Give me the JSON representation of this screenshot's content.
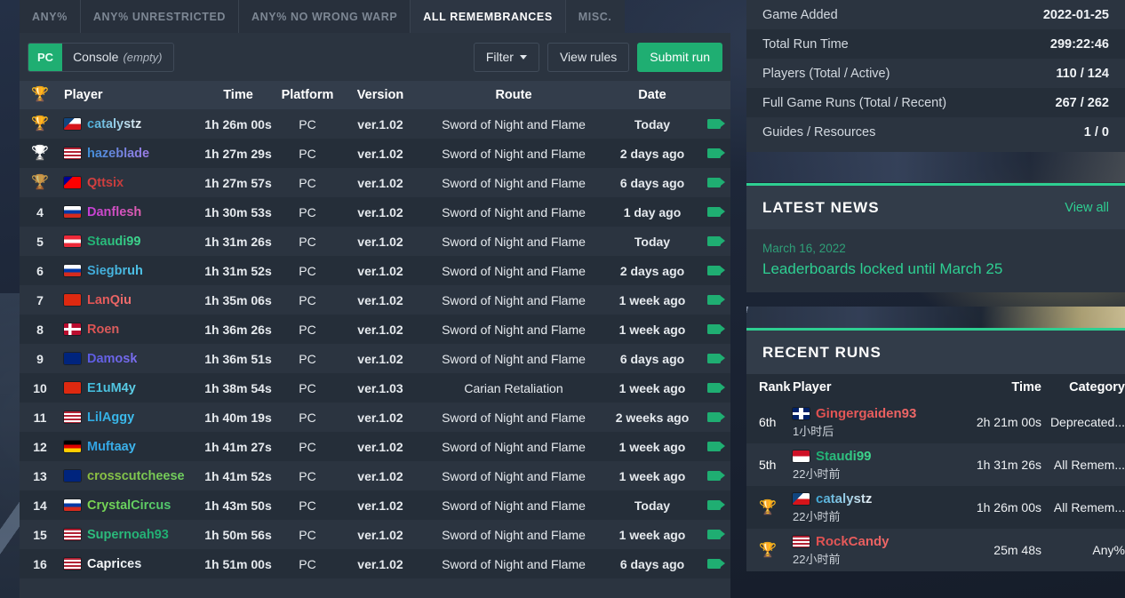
{
  "tabs": [
    {
      "label": "Any%",
      "active": false
    },
    {
      "label": "Any% Unrestricted",
      "active": false
    },
    {
      "label": "Any% No Wrong Warp",
      "active": false
    },
    {
      "label": "All Remembrances",
      "active": true
    },
    {
      "label": "Misc.",
      "active": false
    }
  ],
  "toolbar": {
    "platform_pc": "PC",
    "platform_console": "Console",
    "platform_console_note": "(empty)",
    "filter_label": "Filter",
    "view_rules_label": "View rules",
    "submit_run_label": "Submit run",
    "accent": "#1fae72"
  },
  "leaderboard": {
    "columns": [
      "",
      "Player",
      "Time",
      "Platform",
      "Version",
      "Route",
      "Date",
      ""
    ],
    "rows": [
      {
        "rank": "1",
        "medal": "gold",
        "flag": "cz",
        "player": "catalystz",
        "name_c1": "#3fa9d8",
        "name_c2": "#e8eef3",
        "time": "1h 26m 00s",
        "platform": "PC",
        "version": "ver.1.02",
        "route": "Sword of Night and Flame",
        "date": "Today",
        "video": "video-icon"
      },
      {
        "rank": "2",
        "medal": "silver",
        "flag": "us",
        "player": "hazeblade",
        "name_c1": "#3f8fd8",
        "name_c2": "#9d7ce6",
        "time": "1h 27m 29s",
        "platform": "PC",
        "version": "ver.1.02",
        "route": "Sword of Night and Flame",
        "date": "2 days ago",
        "video": "video-icon"
      },
      {
        "rank": "3",
        "medal": "bronze",
        "flag": "tw",
        "player": "Qttsix",
        "name_c1": "#d84040",
        "name_c2": "#c23c3c",
        "time": "1h 27m 57s",
        "platform": "PC",
        "version": "ver.1.02",
        "route": "Sword of Night and Flame",
        "date": "6 days ago",
        "video": "video-icon"
      },
      {
        "rank": "4",
        "medal": "",
        "flag": "ru",
        "player": "Danflesh",
        "name_c1": "#c43fd8",
        "name_c2": "#e05fb0",
        "time": "1h 30m 53s",
        "platform": "PC",
        "version": "ver.1.02",
        "route": "Sword of Night and Flame",
        "date": "1 day ago",
        "video": "video-icon"
      },
      {
        "rank": "5",
        "medal": "",
        "flag": "at",
        "player": "Staudi99",
        "name_c1": "#1fae72",
        "name_c2": "#3fd88f",
        "time": "1h 31m 26s",
        "platform": "PC",
        "version": "ver.1.02",
        "route": "Sword of Night and Flame",
        "date": "Today",
        "video": "video-icon"
      },
      {
        "rank": "6",
        "medal": "",
        "flag": "ru",
        "player": "Siegbruh",
        "name_c1": "#3fa9d8",
        "name_c2": "#4fc4e8",
        "time": "1h 31m 52s",
        "platform": "PC",
        "version": "ver.1.02",
        "route": "Sword of Night and Flame",
        "date": "2 days ago",
        "video": "video-icon"
      },
      {
        "rank": "7",
        "medal": "",
        "flag": "cn",
        "player": "LanQiu",
        "name_c1": "#e05050",
        "name_c2": "#f07070",
        "time": "1h 35m 06s",
        "platform": "PC",
        "version": "ver.1.02",
        "route": "Sword of Night and Flame",
        "date": "1 week ago",
        "video": "video-icon"
      },
      {
        "rank": "8",
        "medal": "",
        "flag": "no",
        "player": "Roen",
        "name_c1": "#e05050",
        "name_c2": "#d86060",
        "time": "1h 36m 26s",
        "platform": "PC",
        "version": "ver.1.02",
        "route": "Sword of Night and Flame",
        "date": "1 week ago",
        "video": "video-icon"
      },
      {
        "rank": "9",
        "medal": "",
        "flag": "au",
        "player": "Damosk",
        "name_c1": "#5a5ae0",
        "name_c2": "#7b6ef0",
        "time": "1h 36m 51s",
        "platform": "PC",
        "version": "ver.1.02",
        "route": "Sword of Night and Flame",
        "date": "6 days ago",
        "video": "video-icon"
      },
      {
        "rank": "10",
        "medal": "",
        "flag": "cn",
        "player": "E1uM4y",
        "name_c1": "#3fb8d8",
        "name_c2": "#5fd0e8",
        "time": "1h 38m 54s",
        "platform": "PC",
        "version": "ver.1.03",
        "route": "Carian Retaliation",
        "date": "1 week ago",
        "video": "video-icon"
      },
      {
        "rank": "11",
        "medal": "",
        "flag": "us",
        "player": "LilAggy",
        "name_c1": "#2fa8e0",
        "name_c2": "#3fc0f0",
        "time": "1h 40m 19s",
        "platform": "PC",
        "version": "ver.1.02",
        "route": "Sword of Night and Flame",
        "date": "2 weeks ago",
        "video": "video-icon"
      },
      {
        "rank": "12",
        "medal": "",
        "flag": "de",
        "player": "Muftaay",
        "name_c1": "#2f9fe0",
        "name_c2": "#3fb8f0",
        "time": "1h 41m 27s",
        "platform": "PC",
        "version": "ver.1.02",
        "route": "Sword of Night and Flame",
        "date": "1 week ago",
        "video": "video-icon"
      },
      {
        "rank": "13",
        "medal": "",
        "flag": "au",
        "player": "crosscutcheese",
        "name_c1": "#8fbf3f",
        "name_c2": "#6fcf5f",
        "time": "1h 41m 52s",
        "platform": "PC",
        "version": "ver.1.02",
        "route": "Sword of Night and Flame",
        "date": "1 week ago",
        "video": "video-icon"
      },
      {
        "rank": "14",
        "medal": "",
        "flag": "ru",
        "player": "CrystalCircus",
        "name_c1": "#7fd84f",
        "name_c2": "#4fc86f",
        "time": "1h 43m 50s",
        "platform": "PC",
        "version": "ver.1.02",
        "route": "Sword of Night and Flame",
        "date": "Today",
        "video": "video-icon"
      },
      {
        "rank": "15",
        "medal": "",
        "flag": "us",
        "player": "Supernoah93",
        "name_c1": "#2fc07f",
        "name_c2": "#1fae72",
        "time": "1h 50m 56s",
        "platform": "PC",
        "version": "ver.1.02",
        "route": "Sword of Night and Flame",
        "date": "1 week ago",
        "video": "video-icon"
      },
      {
        "rank": "16",
        "medal": "",
        "flag": "us",
        "player": "Caprices",
        "name_c1": "#ffffff",
        "name_c2": "#e8eef3",
        "time": "1h 51m 00s",
        "platform": "PC",
        "version": "ver.1.02",
        "route": "Sword of Night and Flame",
        "date": "6 days ago",
        "video": "video-icon"
      }
    ]
  },
  "sidebar": {
    "stats": [
      {
        "label": "Game Added",
        "value": "2022-01-25"
      },
      {
        "label": "Total Run Time",
        "value": "299:22:46"
      },
      {
        "label": "Players (Total / Active)",
        "value": "110 / 124"
      },
      {
        "label": "Full Game Runs (Total / Recent)",
        "value": "267 / 262"
      },
      {
        "label": "Guides / Resources",
        "value": "1 / 0"
      }
    ],
    "news": {
      "heading": "Latest News",
      "view_all": "View all",
      "date": "March 16, 2022",
      "title": "Leaderboards locked until March 25"
    },
    "recent": {
      "heading": "Recent Runs",
      "columns": [
        "Rank",
        "Player",
        "Time",
        "Category"
      ],
      "rows": [
        {
          "rank": "6th",
          "medal": "",
          "flag": "gb",
          "player": "Gingergaiden93",
          "name_c1": "#e05050",
          "name_c2": "#f06868",
          "ago": "1小时后",
          "time": "2h 21m 00s",
          "category": "Deprecated..."
        },
        {
          "rank": "5th",
          "medal": "",
          "flag": "id",
          "player": "Staudi99",
          "name_c1": "#1fae72",
          "name_c2": "#3fd88f",
          "ago": "22小时前",
          "time": "1h 31m 26s",
          "category": "All Remem..."
        },
        {
          "rank": "",
          "medal": "gold",
          "flag": "cz",
          "player": "catalystz",
          "name_c1": "#3fa9d8",
          "name_c2": "#e8eef3",
          "ago": "22小时前",
          "time": "1h 26m 00s",
          "category": "All Remem..."
        },
        {
          "rank": "",
          "medal": "gold",
          "flag": "us",
          "player": "RockCandy",
          "name_c1": "#e05050",
          "name_c2": "#f06868",
          "ago": "22小时前",
          "time": "25m 48s",
          "category": "Any%"
        }
      ]
    }
  }
}
